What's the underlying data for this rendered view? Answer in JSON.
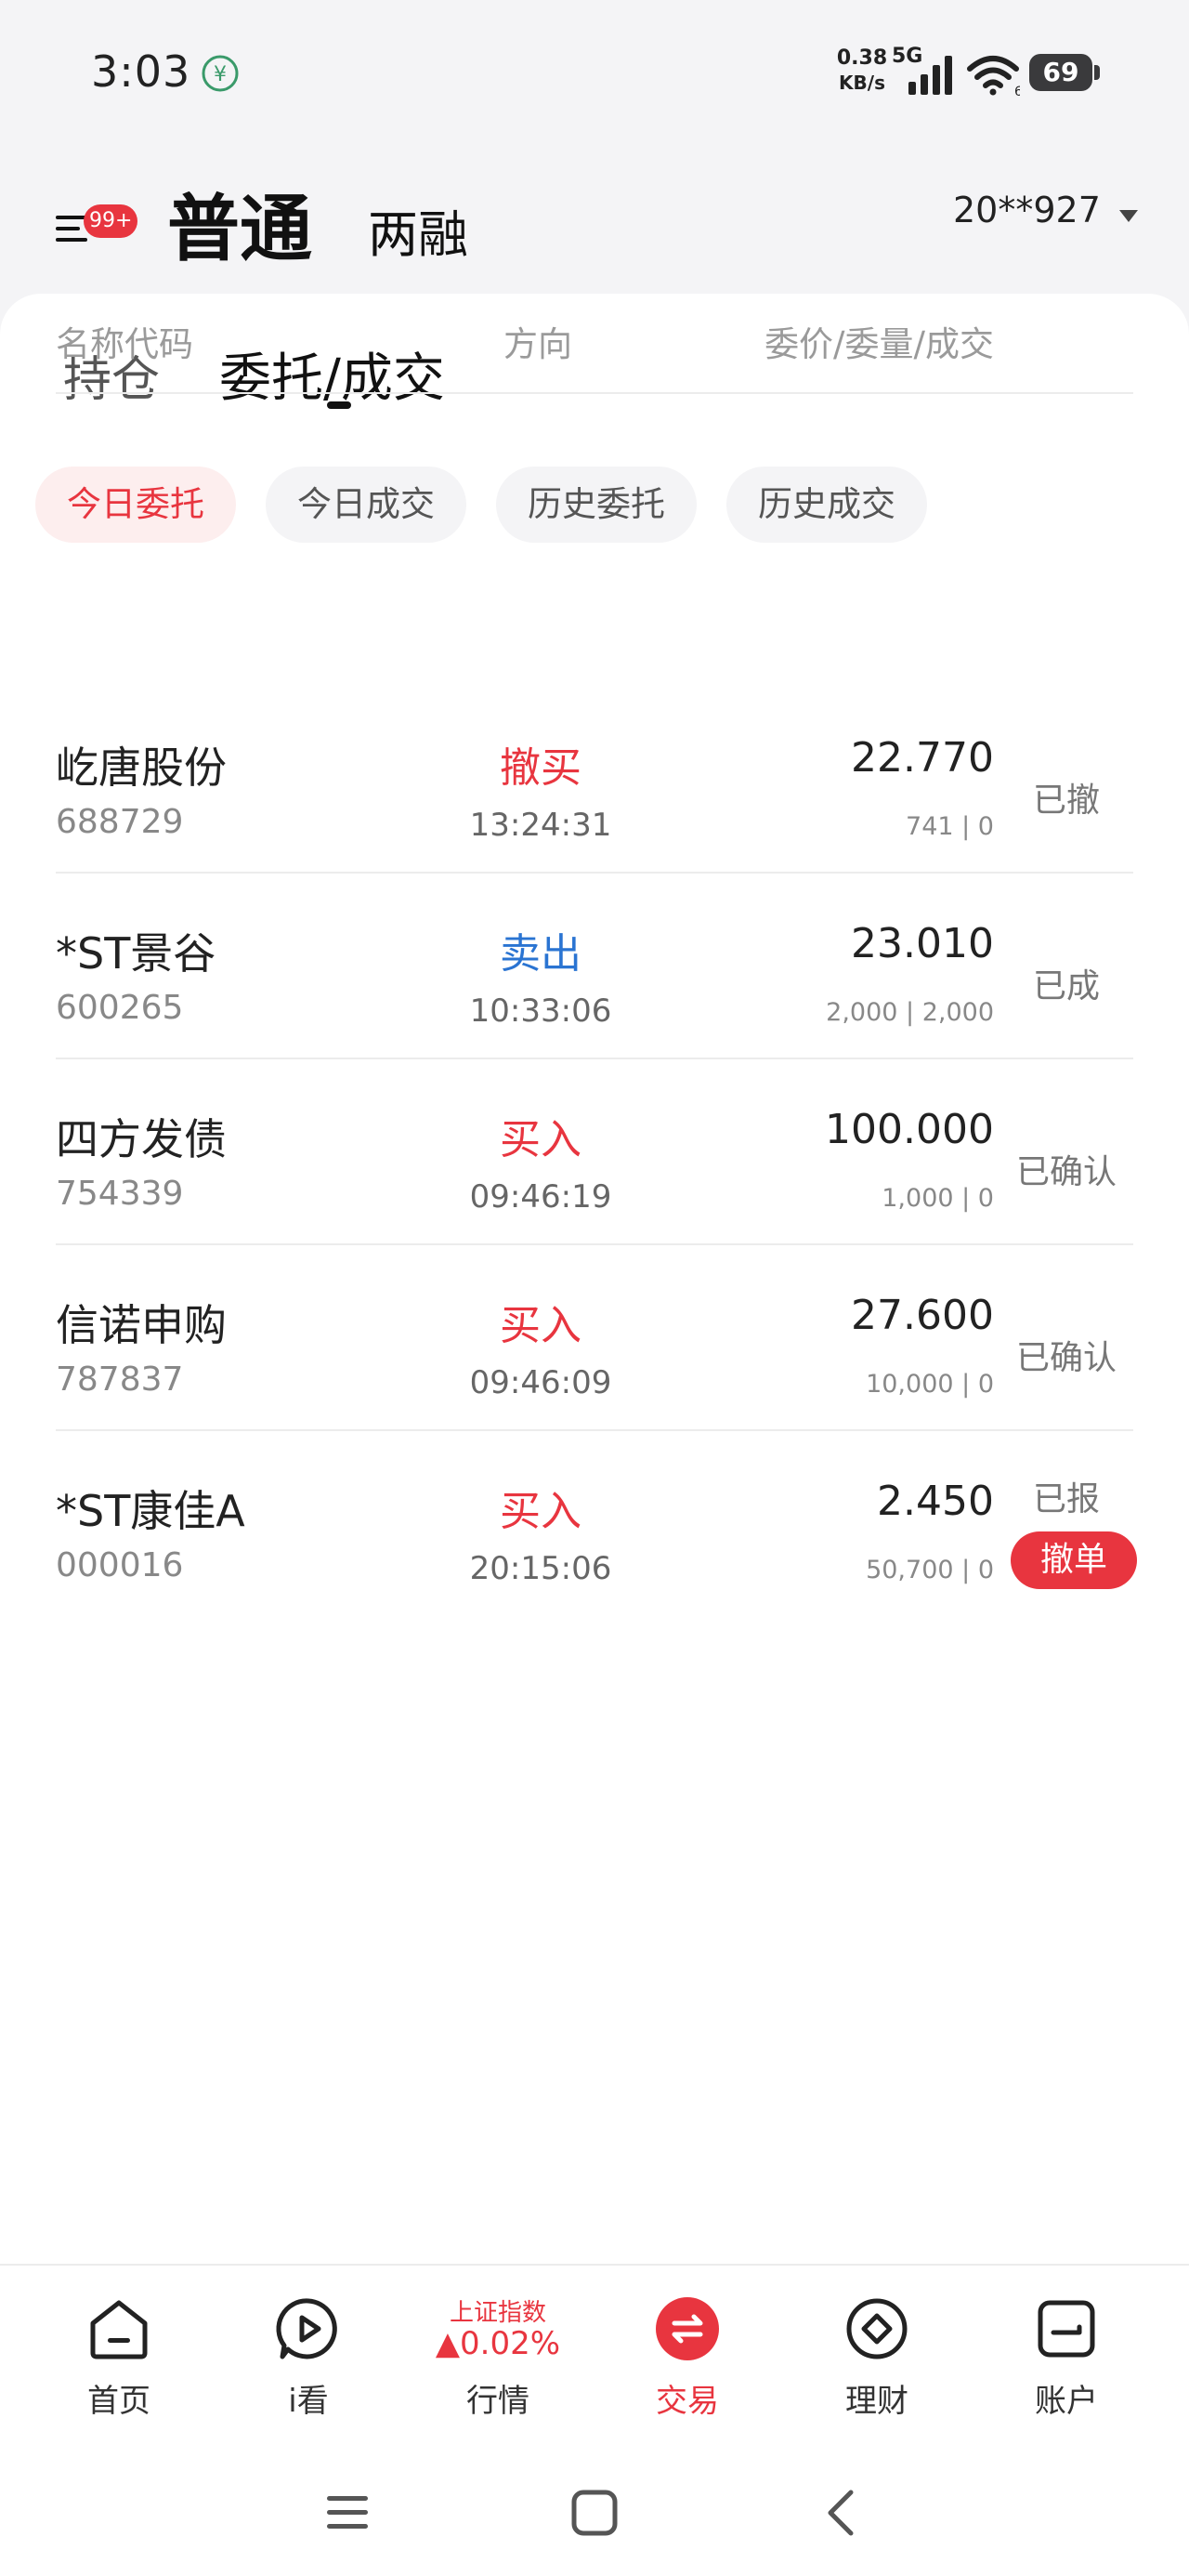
{
  "status_bar": {
    "time": "3:03",
    "net_speed": "0.38",
    "net_unit": "KB/s",
    "network": "5G",
    "wifi_level": "6",
    "battery": "69"
  },
  "header": {
    "badge": "99+",
    "tab_normal": "普通",
    "tab_margin": "两融",
    "account": "20**927"
  },
  "main_tabs": {
    "holdings": "持仓",
    "orders": "委托/成交"
  },
  "sub_tabs": [
    "今日委托",
    "今日成交",
    "历史委托",
    "历史成交"
  ],
  "table": {
    "headers": {
      "name": "名称代码",
      "direction": "方向",
      "price": "委价/委量/成交"
    },
    "rows": [
      {
        "name": "屹唐股份",
        "code": "688729",
        "direction": "撤买",
        "time": "13:24:31",
        "price": "22.770",
        "qty": "741 | 0",
        "status": "已撤"
      },
      {
        "name": "*ST景谷",
        "code": "600265",
        "direction": "卖出",
        "time": "10:33:06",
        "price": "23.010",
        "qty": "2,000 | 2,000",
        "status": "已成"
      },
      {
        "name": "四方发债",
        "code": "754339",
        "direction": "买入",
        "time": "09:46:19",
        "price": "100.000",
        "qty": "1,000 | 0",
        "status": "已确认"
      },
      {
        "name": "信诺申购",
        "code": "787837",
        "direction": "买入",
        "time": "09:46:09",
        "price": "27.600",
        "qty": "10,000 | 0",
        "status": "已确认"
      },
      {
        "name": "*ST康佳A",
        "code": "000016",
        "direction": "买入",
        "time": "20:15:06",
        "price": "2.450",
        "qty": "50,700 | 0",
        "status": "已报",
        "action": "撤单"
      }
    ]
  },
  "bottom_nav": {
    "home": "首页",
    "watch": "i看",
    "market_index": "上证指数",
    "market_change": "▲0.02%",
    "market": "行情",
    "trade": "交易",
    "finance": "理财",
    "account": "账户"
  },
  "colors": {
    "accent_red": "#e8353f",
    "sell_blue": "#2a74d2"
  }
}
